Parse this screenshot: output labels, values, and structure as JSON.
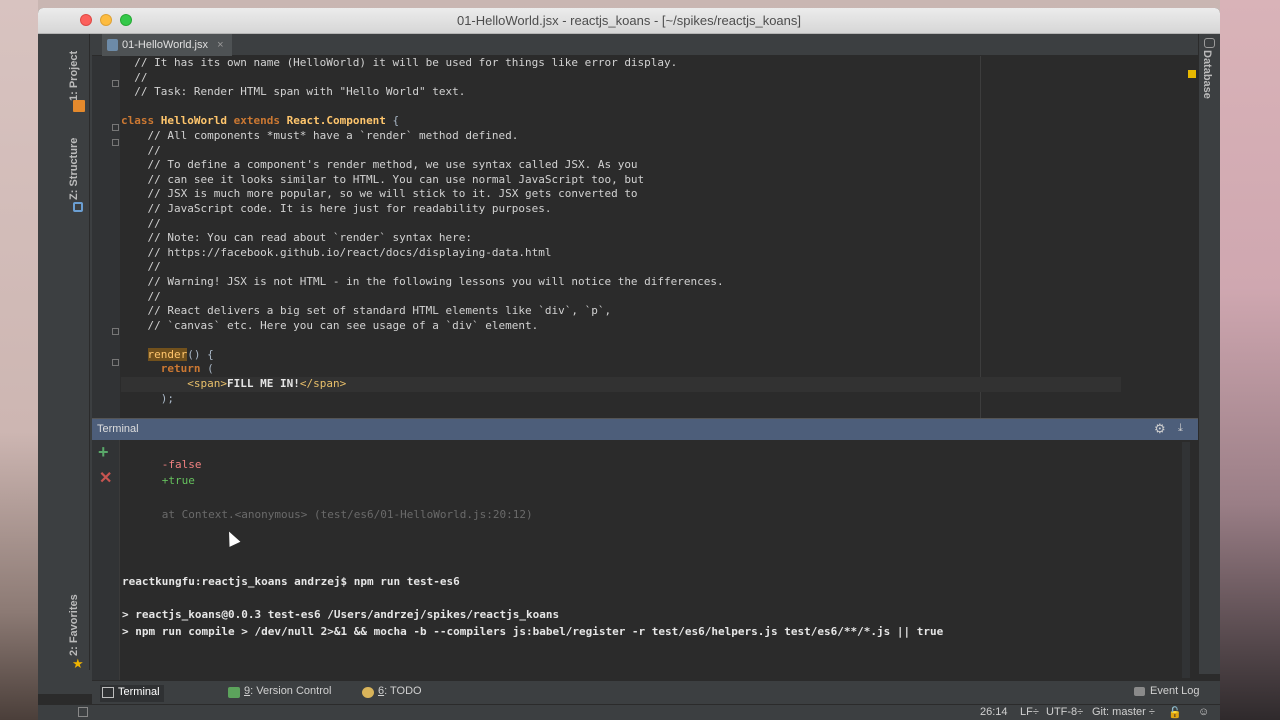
{
  "window": {
    "title": "01-HelloWorld.jsx - reactjs_koans - [~/spikes/reactjs_koans]"
  },
  "left_toolbar": {
    "tabs": [
      "1: Project",
      "Z: Structure",
      "2: Favorites"
    ]
  },
  "right_toolbar": {
    "tabs": [
      "Database"
    ]
  },
  "editor": {
    "tab_label": "01-HelloWorld.jsx",
    "tab_close": "×",
    "lines": [
      [
        {
          "t": "  // It has its own name (HelloWorld) it will be used for things like error display.",
          "c": "cm"
        }
      ],
      [
        {
          "t": "  //",
          "c": "cm"
        }
      ],
      [
        {
          "t": "  // Task: Render HTML span with \"Hello World\" text.",
          "c": "cm"
        }
      ],
      [
        {
          "t": "",
          "c": ""
        }
      ],
      [
        {
          "t": "class ",
          "c": "kw"
        },
        {
          "t": "HelloWorld ",
          "c": "cls"
        },
        {
          "t": "extends ",
          "c": "kw"
        },
        {
          "t": "React.Component",
          "c": "cls"
        },
        {
          "t": " {",
          "c": ""
        }
      ],
      [
        {
          "t": "    // All components *must* have a `render` method defined.",
          "c": "cm"
        }
      ],
      [
        {
          "t": "    //",
          "c": "cm"
        }
      ],
      [
        {
          "t": "    // To define a component's render method, we use syntax called JSX. As you",
          "c": "cm"
        }
      ],
      [
        {
          "t": "    // can see it looks similar to HTML. You can use normal JavaScript too, but",
          "c": "cm"
        }
      ],
      [
        {
          "t": "    // JSX is much more popular, so we will stick to it. JSX gets converted to",
          "c": "cm"
        }
      ],
      [
        {
          "t": "    // JavaScript code. It is here just for readability purposes.",
          "c": "cm"
        }
      ],
      [
        {
          "t": "    //",
          "c": "cm"
        }
      ],
      [
        {
          "t": "    // Note: You can read about `render` syntax here:",
          "c": "cm"
        }
      ],
      [
        {
          "t": "    // https://facebook.github.io/react/docs/displaying-data.html",
          "c": "cm"
        }
      ],
      [
        {
          "t": "    //",
          "c": "cm"
        }
      ],
      [
        {
          "t": "    // Warning! JSX is not HTML - in the following lessons you will notice the differences.",
          "c": "cm"
        }
      ],
      [
        {
          "t": "    //",
          "c": "cm"
        }
      ],
      [
        {
          "t": "    // React delivers a big set of standard HTML elements like `div`, `p`,",
          "c": "cm"
        }
      ],
      [
        {
          "t": "    // `canvas` etc. Here you can see usage of a `div` element.",
          "c": "cm"
        }
      ],
      [
        {
          "t": "",
          "c": ""
        }
      ],
      [
        {
          "t": "    ",
          "c": ""
        },
        {
          "t": "render",
          "c": "hl"
        },
        {
          "t": "() {",
          "c": ""
        }
      ],
      [
        {
          "t": "      ",
          "c": ""
        },
        {
          "t": "return",
          "c": "kw"
        },
        {
          "t": " (",
          "c": ""
        }
      ],
      [
        {
          "t": "          ",
          "c": ""
        },
        {
          "t": "<span>",
          "c": "tag"
        },
        {
          "t": "FILL ME IN!",
          "c": "t-bold"
        },
        {
          "t": "</span>",
          "c": "tag"
        }
      ],
      [
        {
          "t": "      );",
          "c": ""
        }
      ]
    ]
  },
  "terminal": {
    "title": "Terminal",
    "lines": [
      {
        "t": "",
        "c": ""
      },
      {
        "t": "      -false",
        "c": "t-red"
      },
      {
        "t": "      +true",
        "c": "t-green"
      },
      {
        "t": "",
        "c": ""
      },
      {
        "t": "      at Context.<anonymous> (test/es6/01-HelloWorld.js:20:12)",
        "c": "t-dim"
      },
      {
        "t": "",
        "c": ""
      },
      {
        "t": "",
        "c": ""
      },
      {
        "t": "",
        "c": ""
      },
      {
        "t": "reactkungfu:reactjs_koans andrzej$ npm run test-es6",
        "c": "t-bold"
      },
      {
        "t": "",
        "c": ""
      },
      {
        "t": "> reactjs_koans@0.0.3 test-es6 /Users/andrzej/spikes/reactjs_koans",
        "c": "t-bold"
      },
      {
        "t": "> npm run compile > /dev/null 2>&1 && mocha -b --compilers js:babel/register -r test/es6/helpers.js test/es6/**/*.js || true",
        "c": "t-bold"
      }
    ]
  },
  "bottom_tabs": {
    "terminal": "Terminal",
    "version_control_num": "9",
    "version_control": ": Version Control",
    "todo_num": "6",
    "todo": ": TODO",
    "event_log": "Event Log"
  },
  "status": {
    "position": "26:14",
    "line_sep": "LF÷",
    "encoding": "UTF-8÷",
    "git": "Git: master ÷"
  }
}
